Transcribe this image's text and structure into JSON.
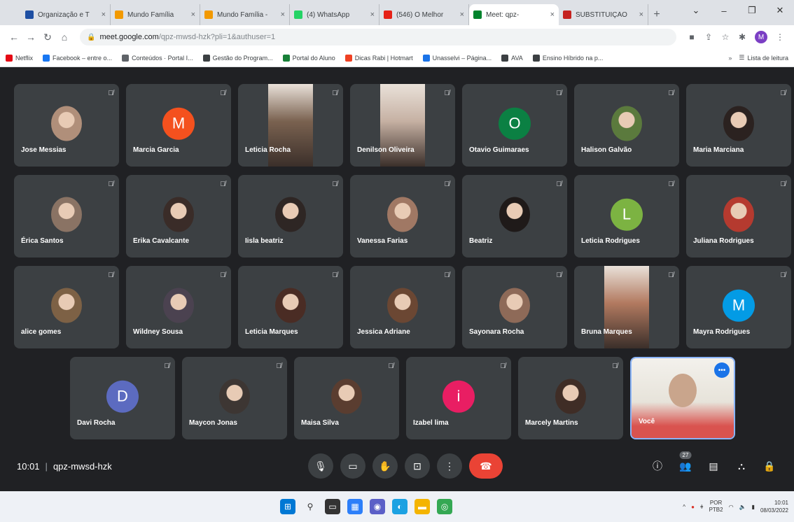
{
  "browser": {
    "tabs": [
      {
        "title": "Organização e T",
        "color": "#1e4fa3",
        "glyph": "▤"
      },
      {
        "title": "Mundo Família",
        "color": "#f29900",
        "glyph": "▤"
      },
      {
        "title": "Mundo Família -",
        "color": "#f29900",
        "glyph": "▤"
      },
      {
        "title": "(4) WhatsApp",
        "color": "#25d366",
        "glyph": "●"
      },
      {
        "title": "(546) O Melhor",
        "color": "#e62117",
        "glyph": "▶"
      },
      {
        "title": "Meet: qpz-",
        "color": "#00832d",
        "glyph": "▶"
      },
      {
        "title": "SUBSTITUIÇÃO",
        "color": "#c5221f",
        "glyph": "M"
      }
    ],
    "new_tab": "+",
    "url_host": "meet.google.com",
    "url_path": "/qpz-mwsd-hzk?pli=1&authuser=1",
    "profile_initial": "M",
    "bookmarks": [
      {
        "label": "Netflix",
        "color": "#e50914"
      },
      {
        "label": "Facebook – entre o...",
        "color": "#1877f2"
      },
      {
        "label": "Conteúdos · Portal I...",
        "color": "#5f6368"
      },
      {
        "label": "Gestão do Program...",
        "color": "#3c4043"
      },
      {
        "label": "Portal do Aluno",
        "color": "#188038"
      },
      {
        "label": "Dicas Rabi | Hotmart",
        "color": "#ef4123"
      },
      {
        "label": "Unasselvi – Página...",
        "color": "#1a73e8"
      },
      {
        "label": "AVA",
        "color": "#3c4043"
      },
      {
        "label": "Ensino Híbrido na p...",
        "color": "#3c4043"
      }
    ],
    "reading_list": "Lista de leitura"
  },
  "participants": [
    {
      "name": "Jose Messias",
      "kind": "photo",
      "color": "#b08f7a"
    },
    {
      "name": "Marcia Garcia",
      "kind": "letter",
      "letter": "M",
      "color": "#f4511e"
    },
    {
      "name": "Leticia Rocha",
      "kind": "video",
      "color": "#7a6250"
    },
    {
      "name": "Denilson Oliveira",
      "kind": "video",
      "color": "#c6b1a3"
    },
    {
      "name": "Otavio Guimaraes",
      "kind": "letter",
      "letter": "O",
      "color": "#0b8043"
    },
    {
      "name": "Halison Galvão",
      "kind": "photo",
      "color": "#5b7a3d"
    },
    {
      "name": "Maria Marciana",
      "kind": "photo",
      "color": "#2b2220"
    },
    {
      "name": "Érica Santos",
      "kind": "photo",
      "color": "#8a7364"
    },
    {
      "name": "Erika Cavalcante",
      "kind": "photo",
      "color": "#3a2c28"
    },
    {
      "name": "Iisla beatriz",
      "kind": "photo",
      "color": "#2e2624"
    },
    {
      "name": "Vanessa Farias",
      "kind": "photo",
      "color": "#a07864"
    },
    {
      "name": "Beatriz",
      "kind": "photo",
      "color": "#1f1a19"
    },
    {
      "name": "Leticia Rodrigues",
      "kind": "letter",
      "letter": "L",
      "color": "#7cb342"
    },
    {
      "name": "Juliana Rodrigues",
      "kind": "photo",
      "color": "#b53a2f"
    },
    {
      "name": "alice gomes",
      "kind": "photo",
      "color": "#7d6145"
    },
    {
      "name": "Wildney Sousa",
      "kind": "photo",
      "color": "#4b4250"
    },
    {
      "name": "Leticia Marques",
      "kind": "photo",
      "color": "#4a2c24"
    },
    {
      "name": "Jessica Adriane",
      "kind": "photo",
      "color": "#6b4733"
    },
    {
      "name": "Sayonara Rocha",
      "kind": "photo",
      "color": "#8e6a58"
    },
    {
      "name": "Bruna Marques",
      "kind": "video",
      "color": "#b27a60"
    },
    {
      "name": "Mayra Rodrigues",
      "kind": "letter",
      "letter": "M",
      "color": "#039be5"
    },
    {
      "name": "Davi Rocha",
      "kind": "letter",
      "letter": "D",
      "color": "#5c6bc0"
    },
    {
      "name": "Maycon Jonas",
      "kind": "photo",
      "color": "#3d3633"
    },
    {
      "name": "Maisa Silva",
      "kind": "photo",
      "color": "#5a3d30"
    },
    {
      "name": "Izabel lima",
      "kind": "letter",
      "letter": "i",
      "color": "#e91e63"
    },
    {
      "name": "Marcely Martins",
      "kind": "photo",
      "color": "#3f2d26"
    },
    {
      "name": "Você",
      "kind": "self",
      "color": "#c9a58c"
    }
  ],
  "controls": {
    "time": "10:01",
    "meeting_code": "qpz-mwsd-hzk",
    "participant_count": "27"
  },
  "taskbar": {
    "lang_top": "POR",
    "lang_bottom": "PTB2",
    "time": "10:01",
    "date": "08/03/2022"
  }
}
